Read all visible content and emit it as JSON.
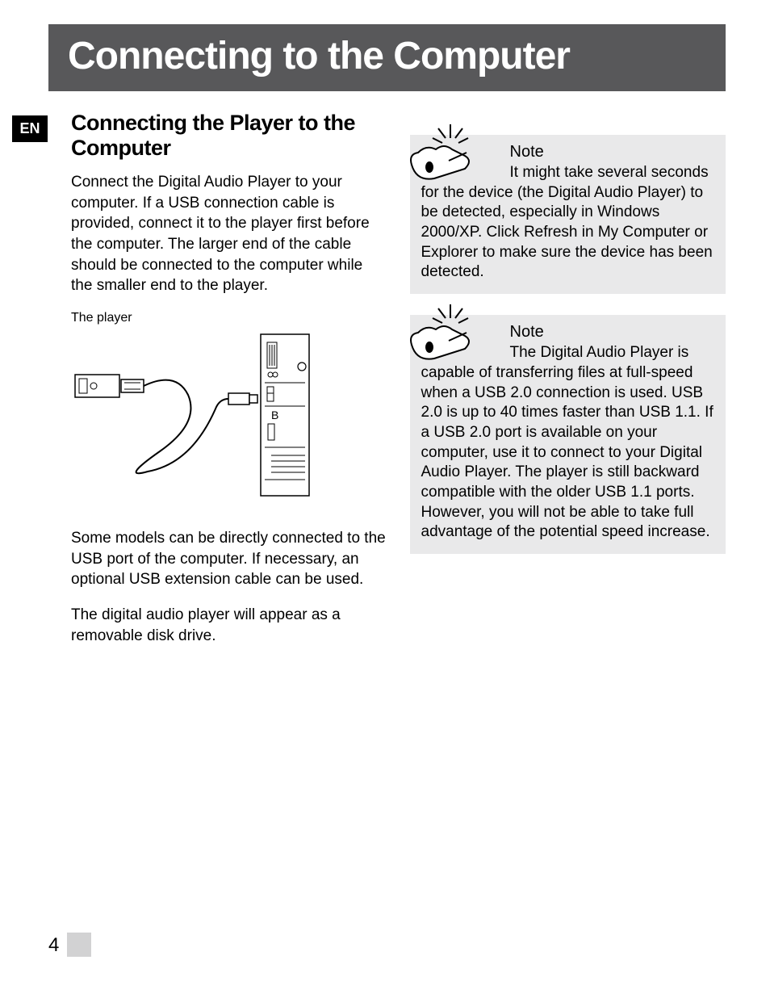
{
  "lang_badge": "EN",
  "title": "Connecting to the Computer",
  "section_heading": "Connecting the Player to the Computer",
  "left": {
    "p1": "Connect the Digital Audio Player to your computer. If a USB connection cable is provided, connect it to the player first before the computer. The larger end of the cable should be connected to the computer while the smaller end to the player.",
    "diagram_caption": "The player",
    "p2": "Some models can be directly connected to the USB port of the computer. If necessary, an optional USB extension cable can be used.",
    "p3": "The digital audio player will appear as a removable disk drive."
  },
  "notes": [
    {
      "label": "Note",
      "text": "It might take several seconds for the device (the Digital Audio Player) to be detected, especially in Windows 2000/XP. Click Refresh in My Computer or Explorer to make sure the device has been detected."
    },
    {
      "label": "Note",
      "text": "The Digital Audio Player is capable of transferring files at full-speed when a USB 2.0 connection is used. USB 2.0 is up to 40 times faster than USB 1.1. If a USB 2.0 port is available on your computer, use it to connect to your Digital Audio Player. The player is still backward compatible with the older USB 1.1 ports. However, you will not be able to take full advantage of the potential speed increase."
    }
  ],
  "page_number": "4"
}
